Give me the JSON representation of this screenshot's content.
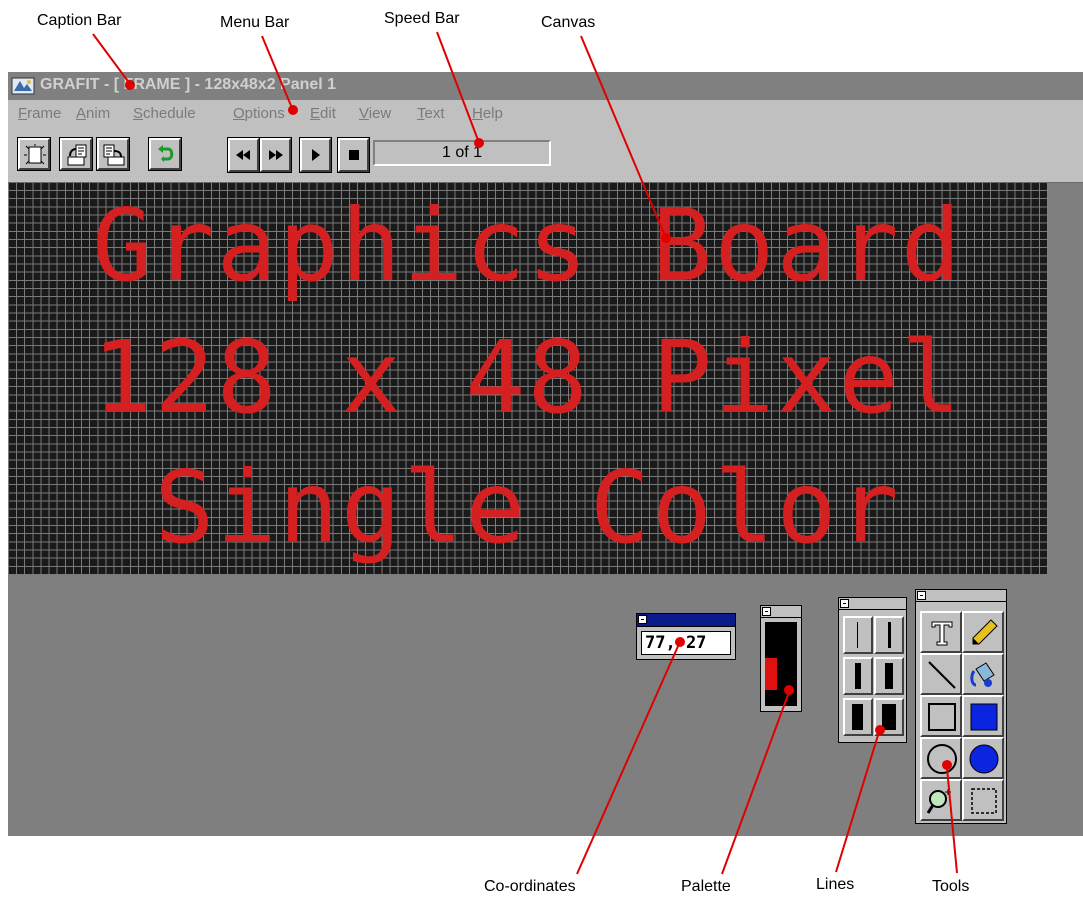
{
  "callouts": {
    "caption_bar": "Caption Bar",
    "menu_bar": "Menu Bar",
    "speed_bar": "Speed Bar",
    "canvas": "Canvas",
    "coordinates": "Co-ordinates",
    "palette": "Palette",
    "lines": "Lines",
    "tools": "Tools"
  },
  "window": {
    "title": "GRAFIT - [ FRAME ] - 128x48x2 Panel 1",
    "menu": [
      "Frame",
      "Anim",
      "Schedule",
      "Options",
      "Edit",
      "View",
      "Text",
      "Help"
    ]
  },
  "toolbar": {
    "frame_counter": "1 of 1"
  },
  "canvas": {
    "lines": [
      "Graphics Board",
      "128 x 48 Pixel",
      "Single Color"
    ],
    "text_color": "#d42020",
    "grid_color": "#7a7a7a",
    "pixel_color": "#1a1a1a"
  },
  "coordinates": {
    "value": "77, 27"
  },
  "palette": {
    "selected_color": "#e01010"
  },
  "tools": [
    "text-tool",
    "pencil-tool",
    "line-tool",
    "fill-tool",
    "rectangle-tool",
    "filled-rectangle-tool",
    "ellipse-tool",
    "filled-ellipse-tool",
    "zoom-tool",
    "selection-tool"
  ]
}
